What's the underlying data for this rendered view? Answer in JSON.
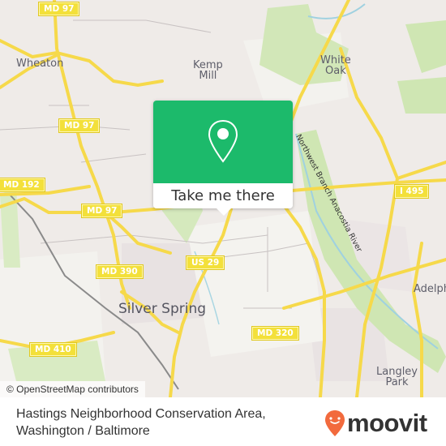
{
  "map": {
    "places": [
      {
        "name": "Wheaton",
        "size": "small"
      },
      {
        "name": "Kemp\nMill",
        "size": "small"
      },
      {
        "name": "White\nOak",
        "size": "small"
      },
      {
        "name": "Silver Spring",
        "size": "big"
      },
      {
        "name": "Adelphi",
        "size": "small"
      },
      {
        "name": "Langley\nPark",
        "size": "small"
      }
    ],
    "shields": [
      {
        "label": "MD 97"
      },
      {
        "label": "MD 97"
      },
      {
        "label": "MD 192"
      },
      {
        "label": "MD 97"
      },
      {
        "label": "MD 390"
      },
      {
        "label": "US 29"
      },
      {
        "label": "MD 320"
      },
      {
        "label": "MD 410"
      },
      {
        "label": "I 495"
      }
    ],
    "river_label": "Northwest Branch Anacostia River",
    "attribution": "© OpenStreetMap contributors"
  },
  "popup": {
    "icon": "map-pin-icon",
    "button_label": "Take me there",
    "accent_color": "#1cba6b"
  },
  "footer": {
    "title_line1": "Hastings Neighborhood Conservation Area,",
    "title_line2": "Washington / Baltimore",
    "logo_text": "moovit",
    "logo_icon": "moovit-pin-icon",
    "logo_color": "#f26a3d"
  }
}
